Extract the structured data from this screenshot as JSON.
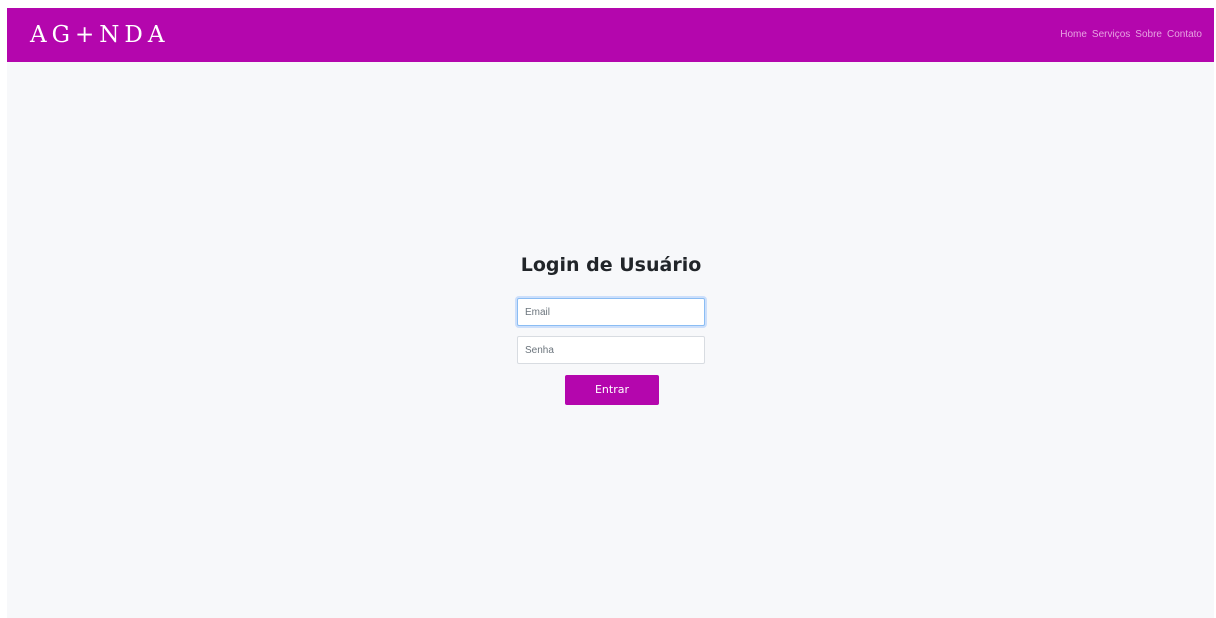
{
  "header": {
    "brand": "AG+NDA",
    "nav": [
      "Home",
      "Serviços",
      "Sobre",
      "Contato"
    ]
  },
  "login": {
    "title": "Login de Usuário",
    "email_placeholder": "Email",
    "password_placeholder": "Senha",
    "submit_label": "Entrar"
  },
  "colors": {
    "brand": "#b406ad",
    "background": "#f7f8fa",
    "focus_ring": "#8bbdf3"
  }
}
